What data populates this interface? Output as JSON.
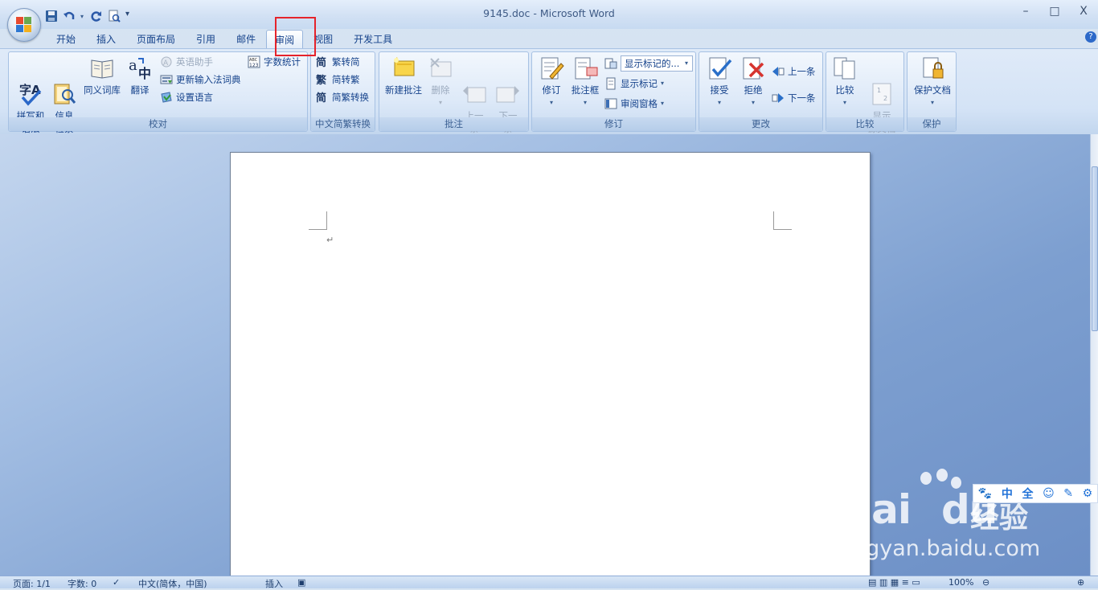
{
  "window": {
    "title": "9145.doc - Microsoft Word",
    "controls": [
      "–",
      "□",
      "X"
    ]
  },
  "quick_access": {
    "items": [
      "save-icon",
      "undo-icon",
      "redo-icon",
      "print-preview-icon",
      "customize-icon"
    ]
  },
  "tabs": [
    {
      "label": "开始"
    },
    {
      "label": "插入"
    },
    {
      "label": "页面布局"
    },
    {
      "label": "引用"
    },
    {
      "label": "邮件"
    },
    {
      "label": "审阅"
    },
    {
      "label": "视图"
    },
    {
      "label": "开发工具"
    }
  ],
  "active_tab": "审阅",
  "ribbon": {
    "proofing": {
      "label": "校对",
      "spelling": "拼写和\n语法",
      "research": "信息\n检索",
      "thesaurus": "同义词库",
      "translate": "翻译",
      "english_assistant": "英语助手",
      "update_ime": "更新输入法词典",
      "set_language": "设置语言",
      "word_count": "字数统计"
    },
    "chinese_conversion": {
      "label": "中文简繁转换",
      "trad_to_simp": "繁转简",
      "simp_to_trad": "简转繁",
      "conversion": "简繁转换"
    },
    "comments": {
      "label": "批注",
      "new_comment": "新建批注",
      "delete": "删除",
      "previous": "上一\n条",
      "next": "下一\n条"
    },
    "tracking": {
      "label": "修订",
      "track_changes": "修订",
      "balloons": "批注框",
      "display_select": "显示标记的...",
      "show_markup": "显示标记",
      "reviewing_pane": "审阅窗格"
    },
    "changes": {
      "label": "更改",
      "accept": "接受",
      "reject": "拒绝",
      "previous": "上一条",
      "next": "下一条"
    },
    "compare": {
      "label": "比较",
      "compare": "比较",
      "show_source": "显示\n源文档"
    },
    "protect": {
      "label": "保护",
      "protect_document": "保护文档"
    }
  },
  "status": {
    "page": "页面: 1/1",
    "words": "字数: 0",
    "language": "中文(简体，中国)",
    "mode": "插入",
    "zoom": "100%"
  },
  "ime_toolbar": [
    "paw-icon",
    "中",
    "全",
    "smiley-icon",
    "pen-icon",
    "gear-icon"
  ],
  "watermark": {
    "brand": "Bai",
    "brand2": "du",
    "jingyan": "经验",
    "url": "jingyan.baidu.com"
  },
  "colors": {
    "highlight_box": "#e5232b",
    "ribbon_text": "#15428b",
    "workspace_bg": "#7d9fd0"
  }
}
